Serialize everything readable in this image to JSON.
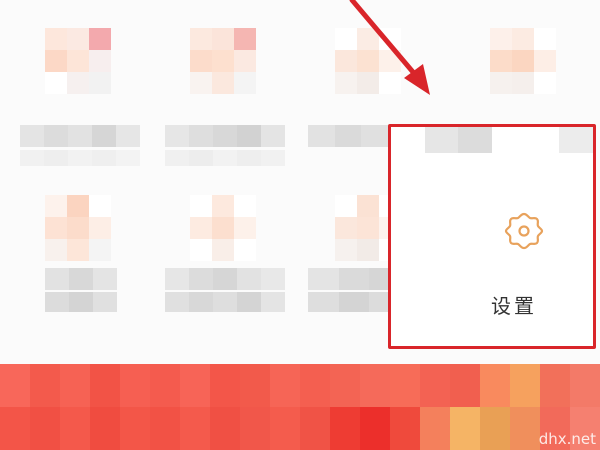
{
  "settings": {
    "label": "设置",
    "icon": "gear-icon",
    "highlight_color": "#d9252a",
    "icon_color": "#e8a25c"
  },
  "annotation": {
    "arrow_color": "#d9252a"
  },
  "banner": {
    "color": "#f24a3c"
  },
  "watermark": {
    "text": "dhx.net"
  }
}
